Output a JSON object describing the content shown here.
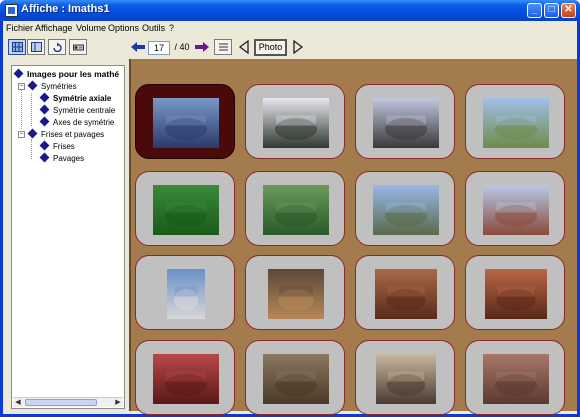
{
  "window": {
    "title": "Affiche : Imaths1",
    "minimize_glyph": "_",
    "maximize_glyph": "□",
    "close_glyph": "✕"
  },
  "menu": [
    "Fichier",
    "Affichage",
    "Volume",
    "Options",
    "Outils",
    "?"
  ],
  "toolbar": {
    "current": "17",
    "total": "/ 40",
    "photo_label": "Photo"
  },
  "tree": {
    "root": "Images pour les mathé",
    "nodes": [
      {
        "label": "Symétries",
        "children": [
          "Symétrie axiale",
          "Symétrie centrale",
          "Axes de symétrie"
        ],
        "selected_child": 0
      },
      {
        "label": "Frises et pavages",
        "children": [
          "Frises",
          "Pavages"
        ]
      }
    ]
  },
  "gallery": {
    "selected_index": 0,
    "thumbnails": [
      {
        "subject": "harbor-boats",
        "colors": [
          "#7a98c8",
          "#2a3a6a"
        ]
      },
      {
        "subject": "river-bridge",
        "colors": [
          "#e8e8f0",
          "#303830"
        ]
      },
      {
        "subject": "riverside-town",
        "colors": [
          "#c0c8e0",
          "#3a3838"
        ]
      },
      {
        "subject": "town-bridge-houses",
        "colors": [
          "#a0c0e8",
          "#708a4a"
        ]
      },
      {
        "subject": "green-leaves",
        "colors": [
          "#3a8a3a",
          "#1a5a1a"
        ]
      },
      {
        "subject": "large-leaf",
        "colors": [
          "#6a9a5a",
          "#2a5a2a"
        ]
      },
      {
        "subject": "chateau",
        "colors": [
          "#98b8e8",
          "#5a6a48"
        ]
      },
      {
        "subject": "brick-church",
        "colors": [
          "#b8c8e8",
          "#8a4a3a"
        ]
      },
      {
        "subject": "rocket-tower",
        "colors": [
          "#6a90c8",
          "#d8d8d8"
        ]
      },
      {
        "subject": "carved-stone-basin",
        "colors": [
          "#5a4838",
          "#b88858"
        ]
      },
      {
        "subject": "carved-face-stone",
        "colors": [
          "#a86a48",
          "#5a2a1a"
        ]
      },
      {
        "subject": "carved-mask-relief",
        "colors": [
          "#b86848",
          "#5a2818"
        ]
      },
      {
        "subject": "red-carved-panel",
        "colors": [
          "#b84848",
          "#5a1818"
        ]
      },
      {
        "subject": "stone-carving",
        "colors": [
          "#8a7860",
          "#4a3828"
        ]
      },
      {
        "subject": "iron-door-knocker",
        "colors": [
          "#c8b8a0",
          "#4a3a30"
        ]
      },
      {
        "subject": "stone-relief-pattern",
        "colors": [
          "#a87868",
          "#5a3830"
        ]
      }
    ]
  }
}
